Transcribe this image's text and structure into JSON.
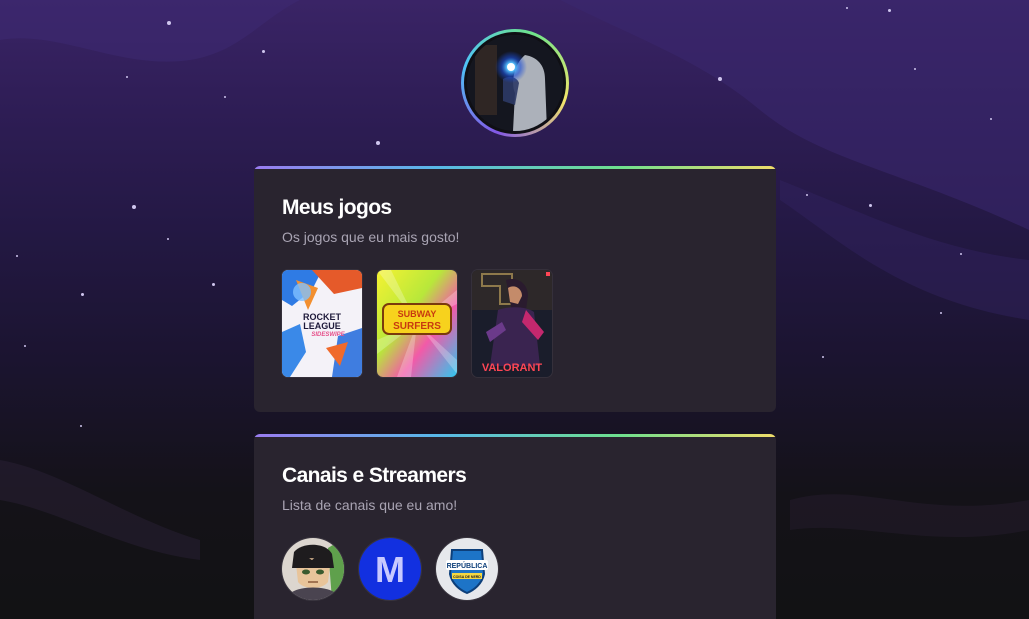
{
  "profile": {
    "avatar_icon": "profile-photo",
    "ring_colors": [
      "#8257e5",
      "#4fc3f7",
      "#6fe38a",
      "#f2e46a"
    ]
  },
  "games_card": {
    "title": "Meus jogos",
    "subtitle": "Os jogos que eu mais gosto!",
    "games": [
      {
        "name": "Rocket League",
        "logo_text": [
          "ROCKET",
          "LEAGUE"
        ],
        "tagline": "SIDESWIPE"
      },
      {
        "name": "Subway Surfers",
        "logo_text": [
          "SUBWAY",
          "SURFERS"
        ]
      },
      {
        "name": "Valorant",
        "logo_text": [
          "VALORANT"
        ]
      }
    ]
  },
  "streamers_card": {
    "title": "Canais e Streamers",
    "subtitle": "Lista de canais que eu amo!",
    "channels": [
      {
        "name": "anime-avatar-channel"
      },
      {
        "name": "m-logo-channel",
        "logo_text": "M"
      },
      {
        "name": "republica-channel",
        "logo_text": [
          "REPÚBLICA",
          "COISA DE NERD"
        ]
      }
    ]
  },
  "colors": {
    "card_bg": "#29242f",
    "title": "#ffffff",
    "subtitle": "#a9a4b3",
    "accent_gradient": [
      "#9a7cf0",
      "#58b8e8",
      "#6ee08e",
      "#f0dd6a"
    ]
  }
}
